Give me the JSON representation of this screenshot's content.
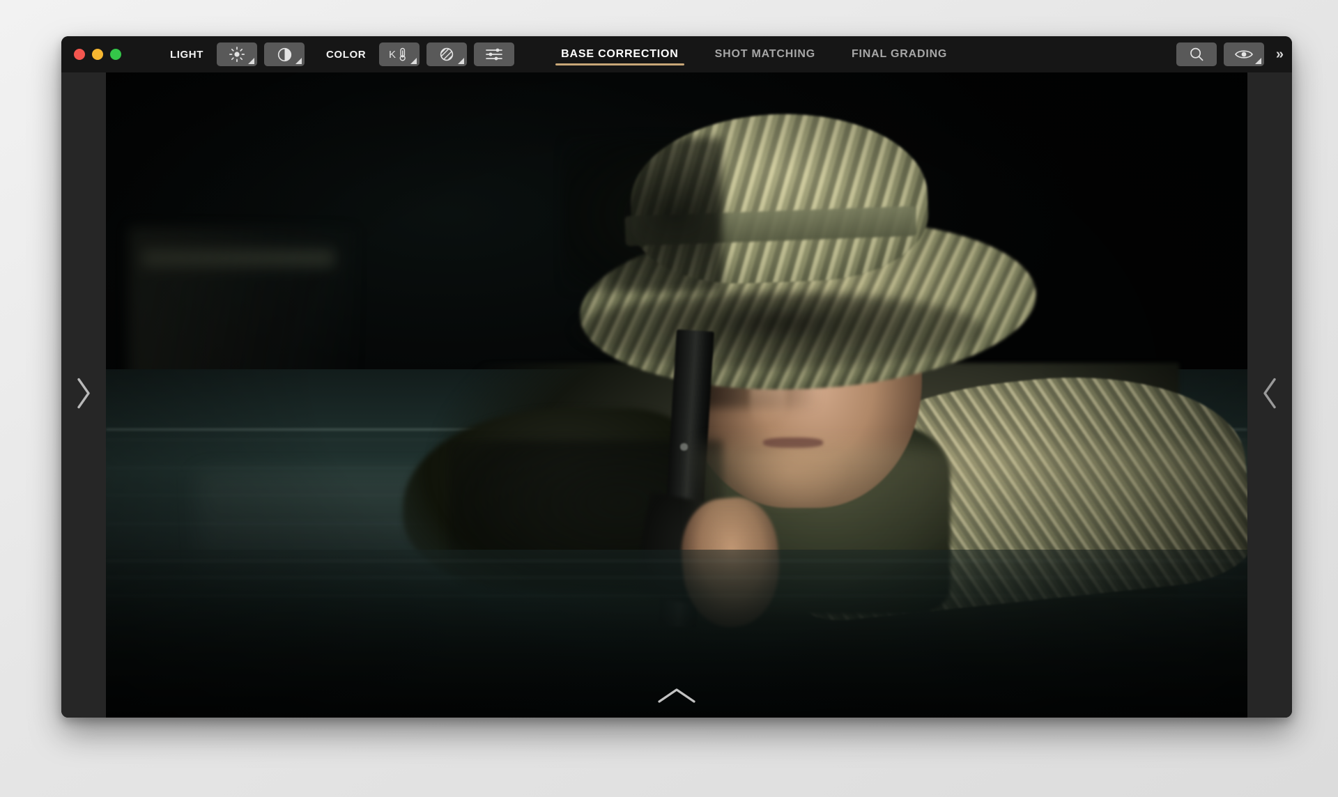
{
  "window": {
    "traffic_lights": [
      {
        "name": "close",
        "color": "#f4564f"
      },
      {
        "name": "minimize",
        "color": "#f7b731"
      },
      {
        "name": "zoom",
        "color": "#34c749"
      }
    ]
  },
  "toolbar": {
    "light_label": "LIGHT",
    "color_label": "COLOR",
    "light_tools": [
      {
        "icon": "brightness-icon",
        "has_corner_marker": true
      },
      {
        "icon": "contrast-icon",
        "has_corner_marker": true
      }
    ],
    "color_tools": [
      {
        "icon": "temperature-kelvin-icon",
        "label": "K",
        "has_corner_marker": true
      },
      {
        "icon": "saturation-icon",
        "has_corner_marker": true
      },
      {
        "icon": "levels-sliders-icon",
        "has_corner_marker": false
      }
    ],
    "right_tools": [
      {
        "icon": "search-icon",
        "has_corner_marker": false
      },
      {
        "icon": "eye-icon",
        "has_corner_marker": true
      }
    ],
    "overflow_label": "»"
  },
  "tabs": [
    {
      "label": "BASE CORRECTION",
      "active": true
    },
    {
      "label": "SHOT MATCHING",
      "active": false
    },
    {
      "label": "FINAL GRADING",
      "active": false
    }
  ],
  "navigation": {
    "left_arrow_icon": "chevron-right-icon",
    "right_arrow_icon": "chevron-left-icon",
    "bottom_arrow_icon": "chevron-up-icon"
  },
  "viewer": {
    "media_description": "Soldier in camouflage boonie hat partially submerged in dark water, aiming a rifle toward the camera at night"
  },
  "colors": {
    "accent_underline": "#c9a878",
    "toolbar_background": "#161616",
    "canvas_background": "#262626",
    "button_background": "#595959",
    "active_tab_text": "#ffffff",
    "inactive_tab_text": "#a7a7a7"
  }
}
